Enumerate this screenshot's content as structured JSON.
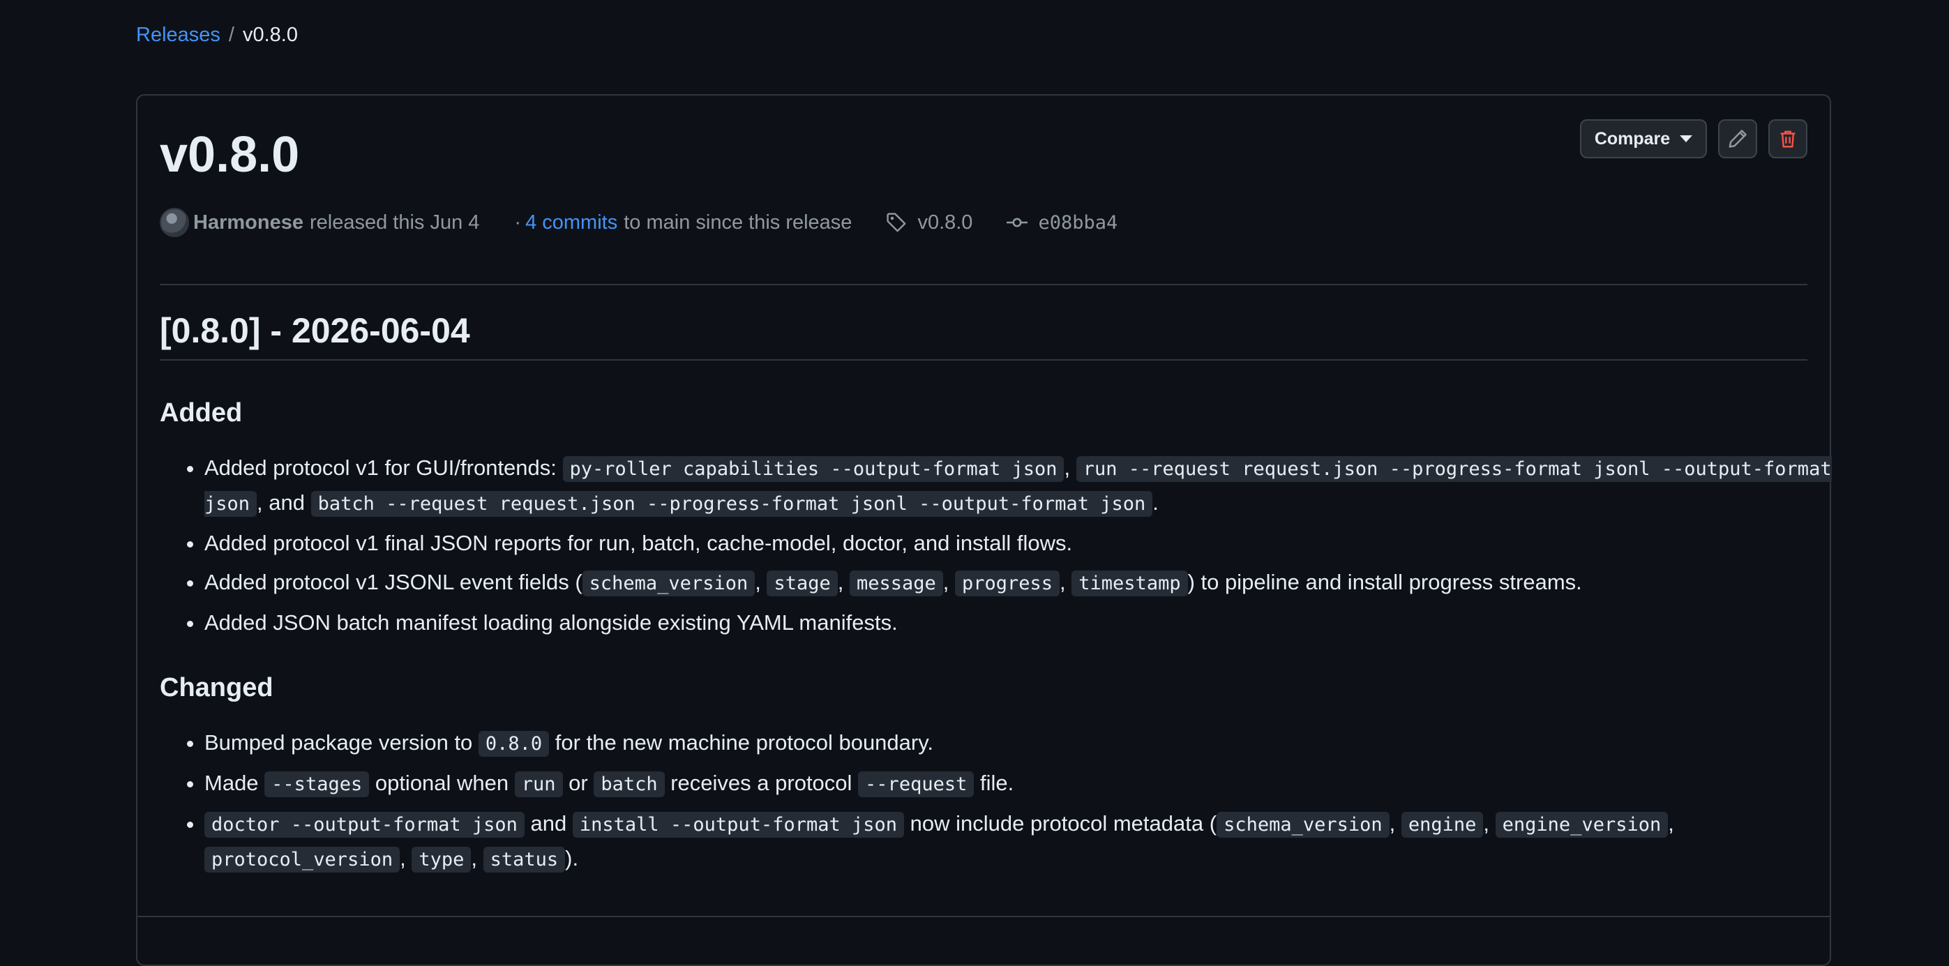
{
  "breadcrumb": {
    "releases_link": "Releases",
    "separator": "/",
    "current": "v0.8.0"
  },
  "release": {
    "title": "v0.8.0",
    "actions": {
      "compare_label": "Compare"
    },
    "meta": {
      "author": "Harmonese",
      "released_text": "released this Jun 4",
      "dot": "·",
      "commits_link": "4 commits",
      "commits_suffix": "to main since this release",
      "tag": "v0.8.0",
      "commit_sha": "e08bba4"
    }
  },
  "notes": {
    "heading": "[0.8.0] - 2026-06-04",
    "added_heading": "Added",
    "added": [
      {
        "t1": "Added protocol v1 for GUI/frontends: ",
        "c1": "py-roller capabilities --output-format json",
        "t2": ", ",
        "c2": "run --request request.json --progress-format jsonl --output-format json",
        "t3": ", and ",
        "c3": "batch --request request.json --progress-format jsonl --output-format json",
        "t4": "."
      },
      {
        "t1": "Added protocol v1 final JSON reports for run, batch, cache-model, doctor, and install flows."
      },
      {
        "t1": "Added protocol v1 JSONL event fields (",
        "c1": "schema_version",
        "t2": ", ",
        "c2": "stage",
        "t3": ", ",
        "c3": "message",
        "t4": ", ",
        "c4": "progress",
        "t5": ", ",
        "c5": "timestamp",
        "t6": ") to pipeline and install progress streams."
      },
      {
        "t1": "Added JSON batch manifest loading alongside existing YAML manifests."
      }
    ],
    "changed_heading": "Changed",
    "changed": [
      {
        "t1": "Bumped package version to ",
        "c1": "0.8.0",
        "t2": " for the new machine protocol boundary."
      },
      {
        "t1": "Made ",
        "c1": "--stages",
        "t2": " optional when ",
        "c2": "run",
        "t3": " or ",
        "c3": "batch",
        "t4": " receives a protocol ",
        "c4": "--request",
        "t5": " file."
      },
      {
        "c1": "doctor --output-format json",
        "t1": " and ",
        "c2": "install --output-format json",
        "t2": " now include protocol metadata (",
        "c3": "schema_version",
        "t3": ", ",
        "c4": "engine",
        "t4": ", ",
        "c5": "engine_version",
        "t5": ", ",
        "c6": "protocol_version",
        "t6": ", ",
        "c7": "type",
        "t7": ", ",
        "c8": "status",
        "t8": ")."
      }
    ]
  },
  "colors": {
    "background": "#0d1117",
    "link": "#4493f8",
    "text": "#e6edf3",
    "muted": "#9198a1",
    "border": "#30363d",
    "code_bg": "#262c36",
    "danger": "#f85149"
  },
  "icons": {
    "edit": "pencil-icon",
    "delete": "trash-icon",
    "tag": "tag-icon",
    "commit": "git-commit-icon",
    "dropdown": "caret-down-icon"
  }
}
